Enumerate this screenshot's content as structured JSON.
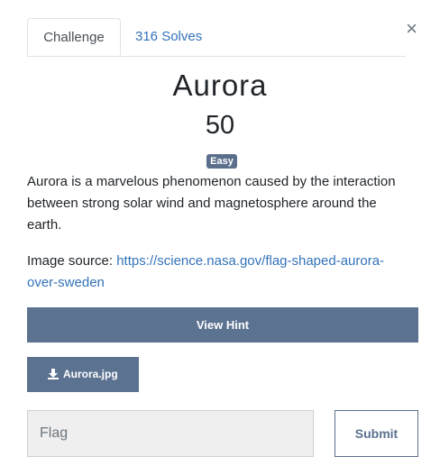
{
  "tabs": {
    "challenge_label": "Challenge",
    "solves_label": "316 Solves"
  },
  "close_symbol": "×",
  "challenge": {
    "name": "Aurora",
    "points": "50",
    "difficulty": "Easy",
    "description": "Aurora is a marvelous phenomenon caused by the interaction between strong solar wind and magnetosphere around the earth.",
    "image_source_label": "Image source: ",
    "image_source_url": "https://science.nasa.gov/flag-shaped-aurora-over-sweden"
  },
  "buttons": {
    "hint_label": "View Hint",
    "file_label": "Aurora.jpg",
    "submit_label": "Submit"
  },
  "flag_input": {
    "placeholder": "Flag",
    "value": ""
  },
  "colors": {
    "accent": "#5b7290",
    "link": "#3373b9"
  },
  "icons": {
    "file": "download-icon",
    "close": "close-icon"
  }
}
